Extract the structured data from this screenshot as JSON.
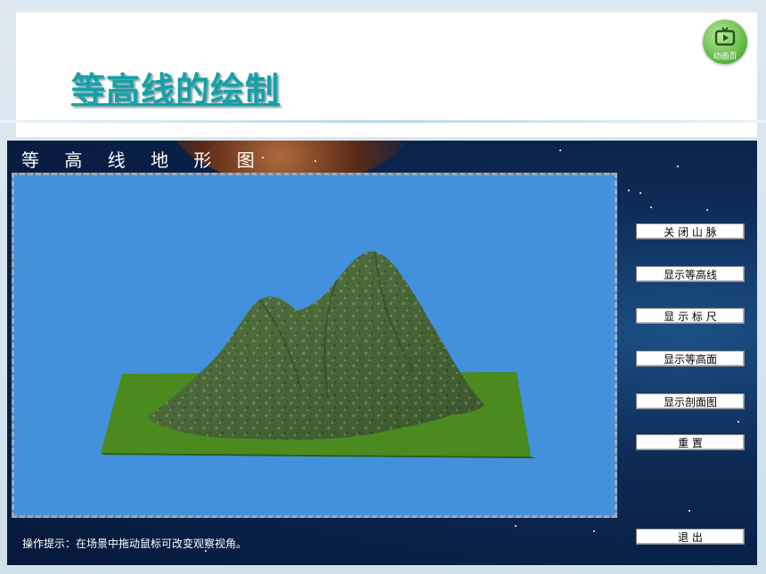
{
  "slide": {
    "title": "等高线的绘制",
    "animation_badge_label": "动画页"
  },
  "app": {
    "title": "等 高 线 地 形 图",
    "hint": "操作提示：在场景中拖动鼠标可改变观察视角。",
    "buttons": {
      "close_mountain": "关 闭 山 脉",
      "show_contours": "显示等高线",
      "show_ruler": "显 示 标 尺",
      "show_contour_surface": "显示等高面",
      "show_profile": "显示剖面图",
      "reset": "重    置",
      "exit": "退    出"
    }
  },
  "colors": {
    "title_teal": "#16a0a8",
    "viewport_blue": "#4390dc",
    "ground_green": "#3f8a1c",
    "mountain_green": "#4a6e3a"
  },
  "icons": {
    "badge": "play-icon"
  }
}
